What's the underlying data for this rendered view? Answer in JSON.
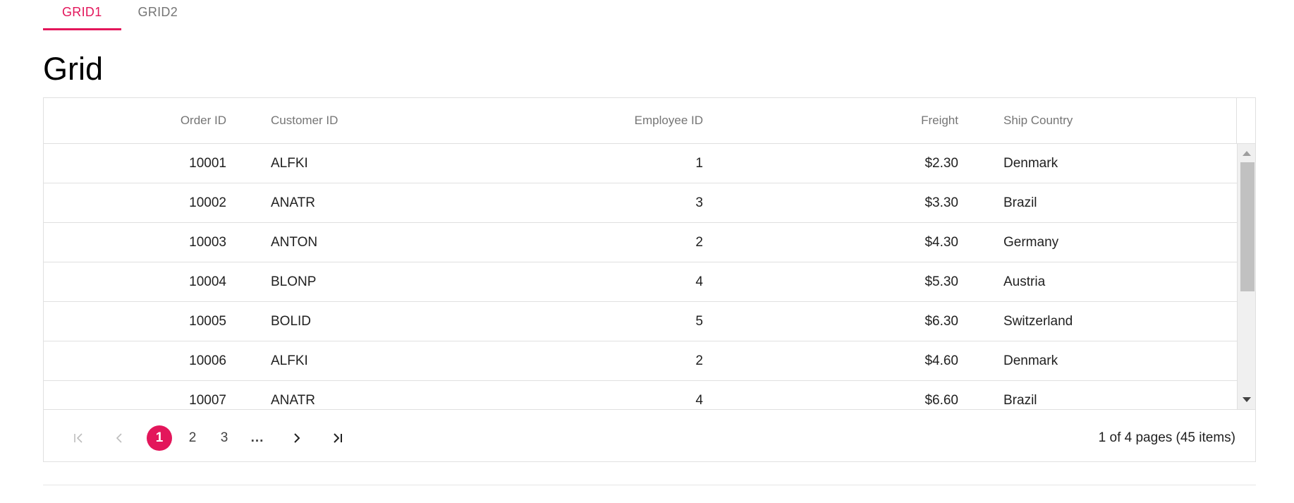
{
  "tabs": [
    {
      "label": "GRID1",
      "active": true
    },
    {
      "label": "GRID2",
      "active": false
    }
  ],
  "page_title": "Grid",
  "grid": {
    "columns": {
      "order_id": "Order ID",
      "customer_id": "Customer ID",
      "employee_id": "Employee ID",
      "freight": "Freight",
      "ship_country": "Ship Country"
    },
    "rows": [
      {
        "order_id": "10001",
        "customer_id": "ALFKI",
        "employee_id": "1",
        "freight": "$2.30",
        "ship_country": "Denmark"
      },
      {
        "order_id": "10002",
        "customer_id": "ANATR",
        "employee_id": "3",
        "freight": "$3.30",
        "ship_country": "Brazil"
      },
      {
        "order_id": "10003",
        "customer_id": "ANTON",
        "employee_id": "2",
        "freight": "$4.30",
        "ship_country": "Germany"
      },
      {
        "order_id": "10004",
        "customer_id": "BLONP",
        "employee_id": "4",
        "freight": "$5.30",
        "ship_country": "Austria"
      },
      {
        "order_id": "10005",
        "customer_id": "BOLID",
        "employee_id": "5",
        "freight": "$6.30",
        "ship_country": "Switzerland"
      },
      {
        "order_id": "10006",
        "customer_id": "ALFKI",
        "employee_id": "2",
        "freight": "$4.60",
        "ship_country": "Denmark"
      },
      {
        "order_id": "10007",
        "customer_id": "ANATR",
        "employee_id": "4",
        "freight": "$6.60",
        "ship_country": "Brazil"
      }
    ]
  },
  "pager": {
    "first_icon": "first-page-icon",
    "prev_icon": "prev-page-icon",
    "next_icon": "next-page-icon",
    "last_icon": "last-page-icon",
    "pages": [
      "1",
      "2",
      "3"
    ],
    "current_page": "1",
    "ellipsis": "...",
    "info": "1 of 4 pages (45 items)"
  },
  "colors": {
    "accent": "#e3165b",
    "header_text": "#757575",
    "border": "#e0e0e0"
  }
}
